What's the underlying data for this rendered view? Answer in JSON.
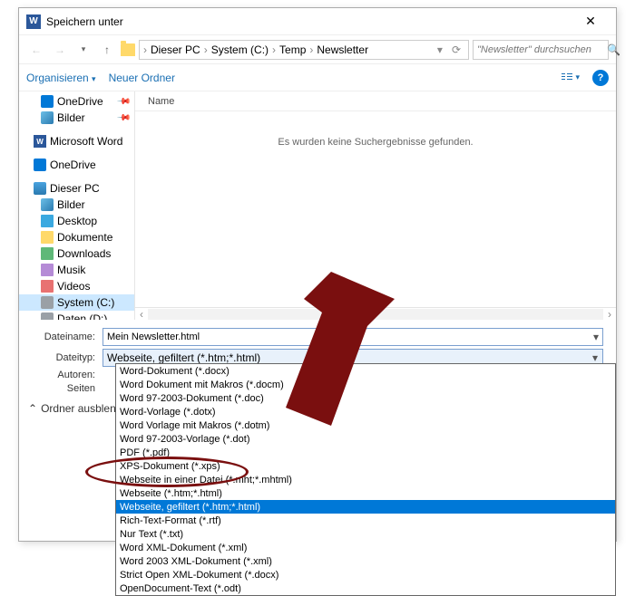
{
  "title": "Speichern unter",
  "breadcrumb": {
    "root": "Dieser PC",
    "p1": "System (C:)",
    "p2": "Temp",
    "p3": "Newsletter"
  },
  "search": {
    "placeholder": "\"Newsletter\" durchsuchen"
  },
  "toolbar": {
    "organize": "Organisieren",
    "newfolder": "Neuer Ordner"
  },
  "tree": {
    "onedrive1": "OneDrive",
    "bilder1": "Bilder",
    "word": "Microsoft Word",
    "onedrive2": "OneDrive",
    "pc": "Dieser PC",
    "bilder2": "Bilder",
    "desktop": "Desktop",
    "dokumente": "Dokumente",
    "downloads": "Downloads",
    "musik": "Musik",
    "videos": "Videos",
    "systemc": "System (C:)",
    "datend": "Daten (D:)"
  },
  "content": {
    "col_name": "Name",
    "empty": "Es wurden keine Suchergebnisse gefunden."
  },
  "form": {
    "filename_label": "Dateiname:",
    "filename_value": "Mein Newsletter.html",
    "filetype_label": "Dateityp:",
    "filetype_value": "Webseite, gefiltert (*.htm;*.html)",
    "authors_label": "Autoren:",
    "pages_label": "Seiten"
  },
  "filetypes": [
    "Word-Dokument (*.docx)",
    "Word Dokument mit Makros (*.docm)",
    "Word 97-2003-Dokument (*.doc)",
    "Word-Vorlage (*.dotx)",
    "Word Vorlage mit Makros (*.dotm)",
    "Word 97-2003-Vorlage (*.dot)",
    "PDF (*.pdf)",
    "XPS-Dokument (*.xps)",
    "Webseite in einer Datei (*.mht;*.mhtml)",
    "Webseite (*.htm;*.html)",
    "Webseite, gefiltert (*.htm;*.html)",
    "Rich-Text-Format (*.rtf)",
    "Nur Text (*.txt)",
    "Word XML-Dokument (*.xml)",
    "Word 2003 XML-Dokument (*.xml)",
    "Strict Open XML-Dokument (*.docx)",
    "OpenDocument-Text (*.odt)"
  ],
  "filetype_selected_index": 10,
  "hide_folders": "Ordner ausblende"
}
